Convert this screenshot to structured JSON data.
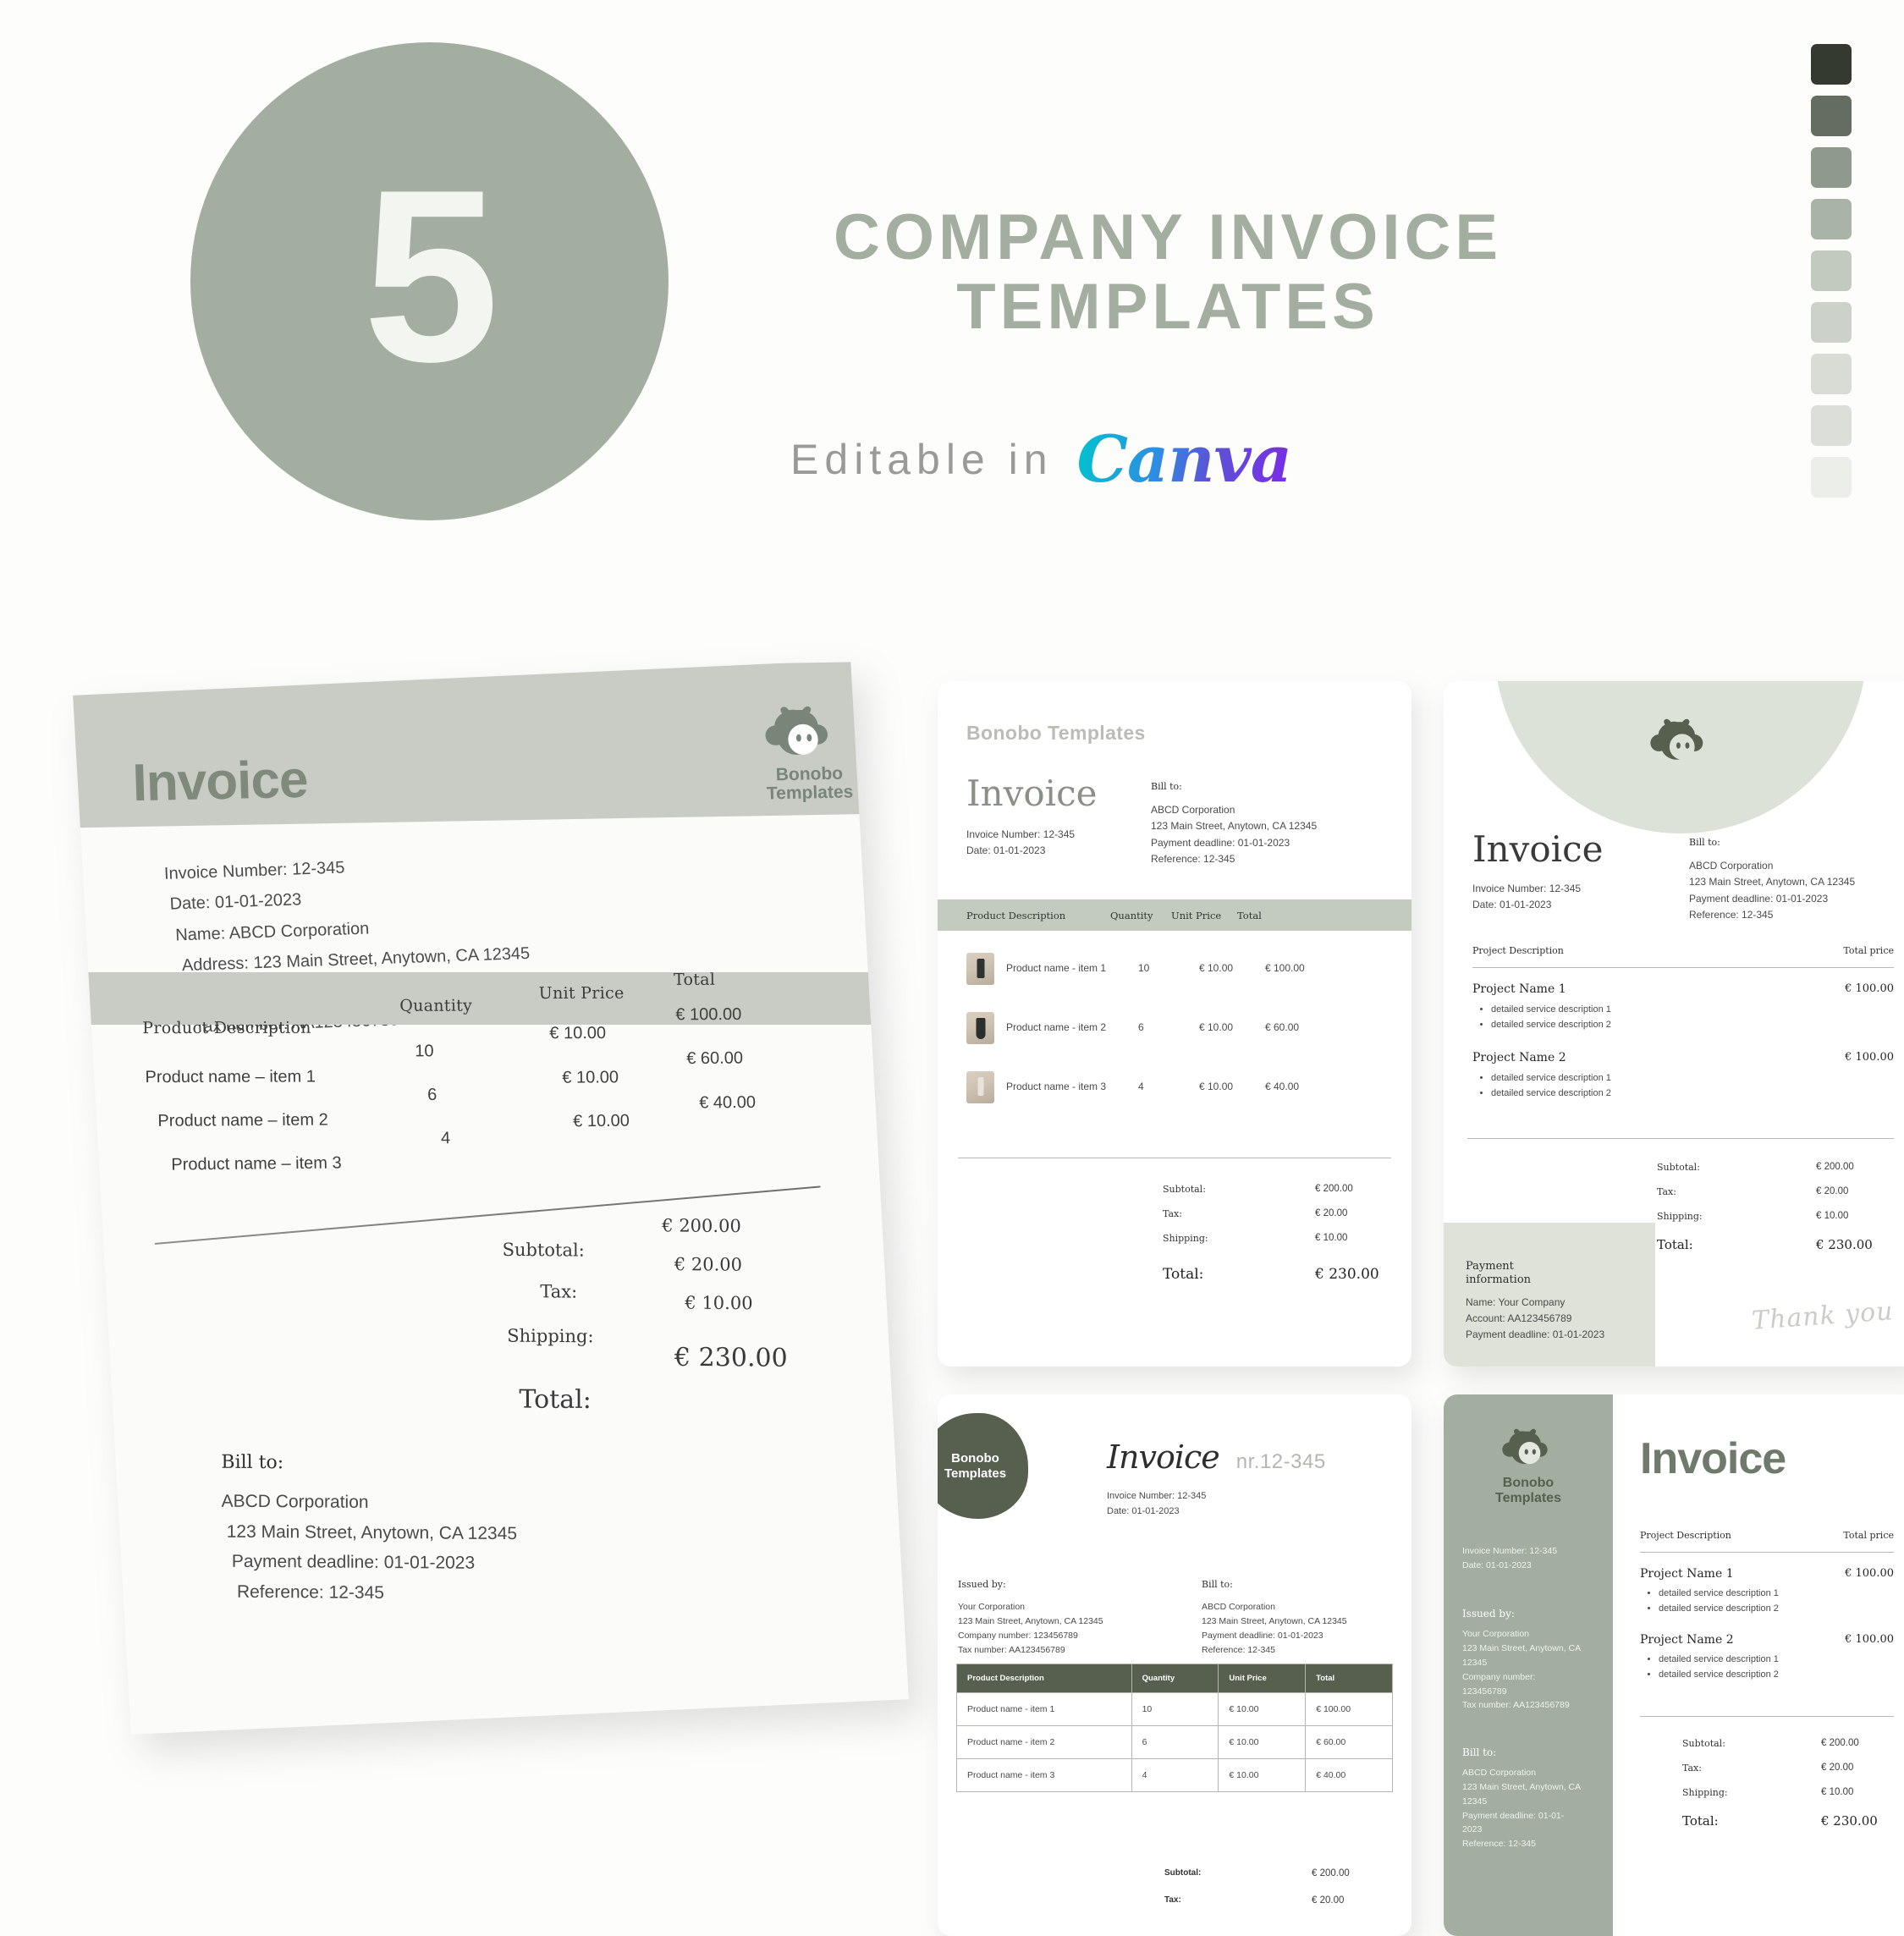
{
  "hero": {
    "number": "5",
    "title": "COMPANY INVOICE TEMPLATES",
    "subtitle": "Editable in",
    "brand_logo": "Canva",
    "circle_color": "#a3aea1",
    "title_color": "#a3aea1"
  },
  "swatches": [
    {
      "name": "swatch-1",
      "hex": "#343a30"
    },
    {
      "name": "swatch-2",
      "hex": "#656d61"
    },
    {
      "name": "swatch-3",
      "hex": "#909a8c"
    },
    {
      "name": "swatch-4",
      "hex": "#a9b3a6"
    },
    {
      "name": "swatch-5",
      "hex": "#c2c9bf"
    },
    {
      "name": "swatch-6",
      "hex": "#ccd2c9"
    },
    {
      "name": "swatch-7",
      "hex": "#d8dcd5"
    },
    {
      "name": "swatch-8",
      "hex": "#dcdeda"
    },
    {
      "name": "swatch-9",
      "hex": "#eceee9"
    }
  ],
  "brand": {
    "line1": "Bonobo",
    "line2": "Templates",
    "full": "Bonobo Templates"
  },
  "labels": {
    "invoice": "Invoice",
    "bill_to": "Bill to:",
    "issued_by": "Issued by:",
    "payment_information": "Payment information",
    "payment_info_line1": "Payment",
    "payment_info_line2": "information",
    "thank_you": "Thank you",
    "subtotal": "Subtotal:",
    "tax": "Tax:",
    "shipping": "Shipping:",
    "total": "Total:",
    "product_description": "Product Description",
    "quantity": "Quantity",
    "unit_price": "Unit Price",
    "total_col": "Total",
    "project_description": "Project Description",
    "total_price": "Total price"
  },
  "invoice_meta": {
    "invoice_number": "Invoice Number: 12-345",
    "date": "Date: 01-01-2023",
    "name": "Name: ABCD Corporation",
    "address": "Address: 123 Main Street, Anytown, CA 12345",
    "company_number": "Company number: 123456789",
    "tax_number": "Tax number: AA123456789",
    "nr_label": "nr.12-345"
  },
  "bill_to": {
    "company": "ABCD Corporation",
    "address": "123 Main Street, Anytown, CA 12345",
    "payment_deadline": "Payment deadline: 01-01-2023",
    "reference": "Reference: 12-345"
  },
  "bill_to_wrapped": {
    "company": "ABCD Corporation",
    "address_l1": "123 Main Street, Anytown, CA",
    "address_l2": "12345",
    "payment_deadline_l1": "Payment deadline: 01-01-",
    "payment_deadline_l2": "2023",
    "reference": "Reference: 12-345"
  },
  "issued_by": {
    "company": "Your Corporation",
    "address": "123 Main Street, Anytown, CA 12345",
    "company_number": "Company number: 123456789",
    "tax_number": "Tax number: AA123456789"
  },
  "issued_by_wrapped": {
    "company": "Your Corporation",
    "address_l1": "123 Main Street, Anytown, CA",
    "address_l2": "12345",
    "company_number_l1": "Company number:",
    "company_number_l2": "123456789",
    "tax_number": "Tax number: AA123456789"
  },
  "payment_information": {
    "name": "Name: Your Company",
    "account": "Account: AA123456789",
    "payment_deadline": "Payment deadline: 01-01-2023"
  },
  "line_items": [
    {
      "description": "Product name - item 1",
      "description_alt": "Product name – item 1",
      "quantity": "10",
      "unit_price": "€ 10.00",
      "total": "€ 100.00"
    },
    {
      "description": "Product name - item 2",
      "description_alt": "Product name – item 2",
      "quantity": "6",
      "unit_price": "€ 10.00",
      "total": "€ 60.00"
    },
    {
      "description": "Product name - item 3",
      "description_alt": "Product name – item 3",
      "quantity": "4",
      "unit_price": "€ 10.00",
      "total": "€ 40.00"
    }
  ],
  "projects": [
    {
      "name": "Project Name 1",
      "price": "€ 100.00",
      "bullet1": "detailed service description 1",
      "bullet2": "detailed service description 2"
    },
    {
      "name": "Project Name 2",
      "price": "€ 100.00",
      "bullet1": "detailed service description 1",
      "bullet2": "detailed service description 2"
    }
  ],
  "totals": {
    "subtotal": "€ 200.00",
    "tax": "€ 20.00",
    "shipping": "€ 10.00",
    "total": "€ 230.00"
  }
}
